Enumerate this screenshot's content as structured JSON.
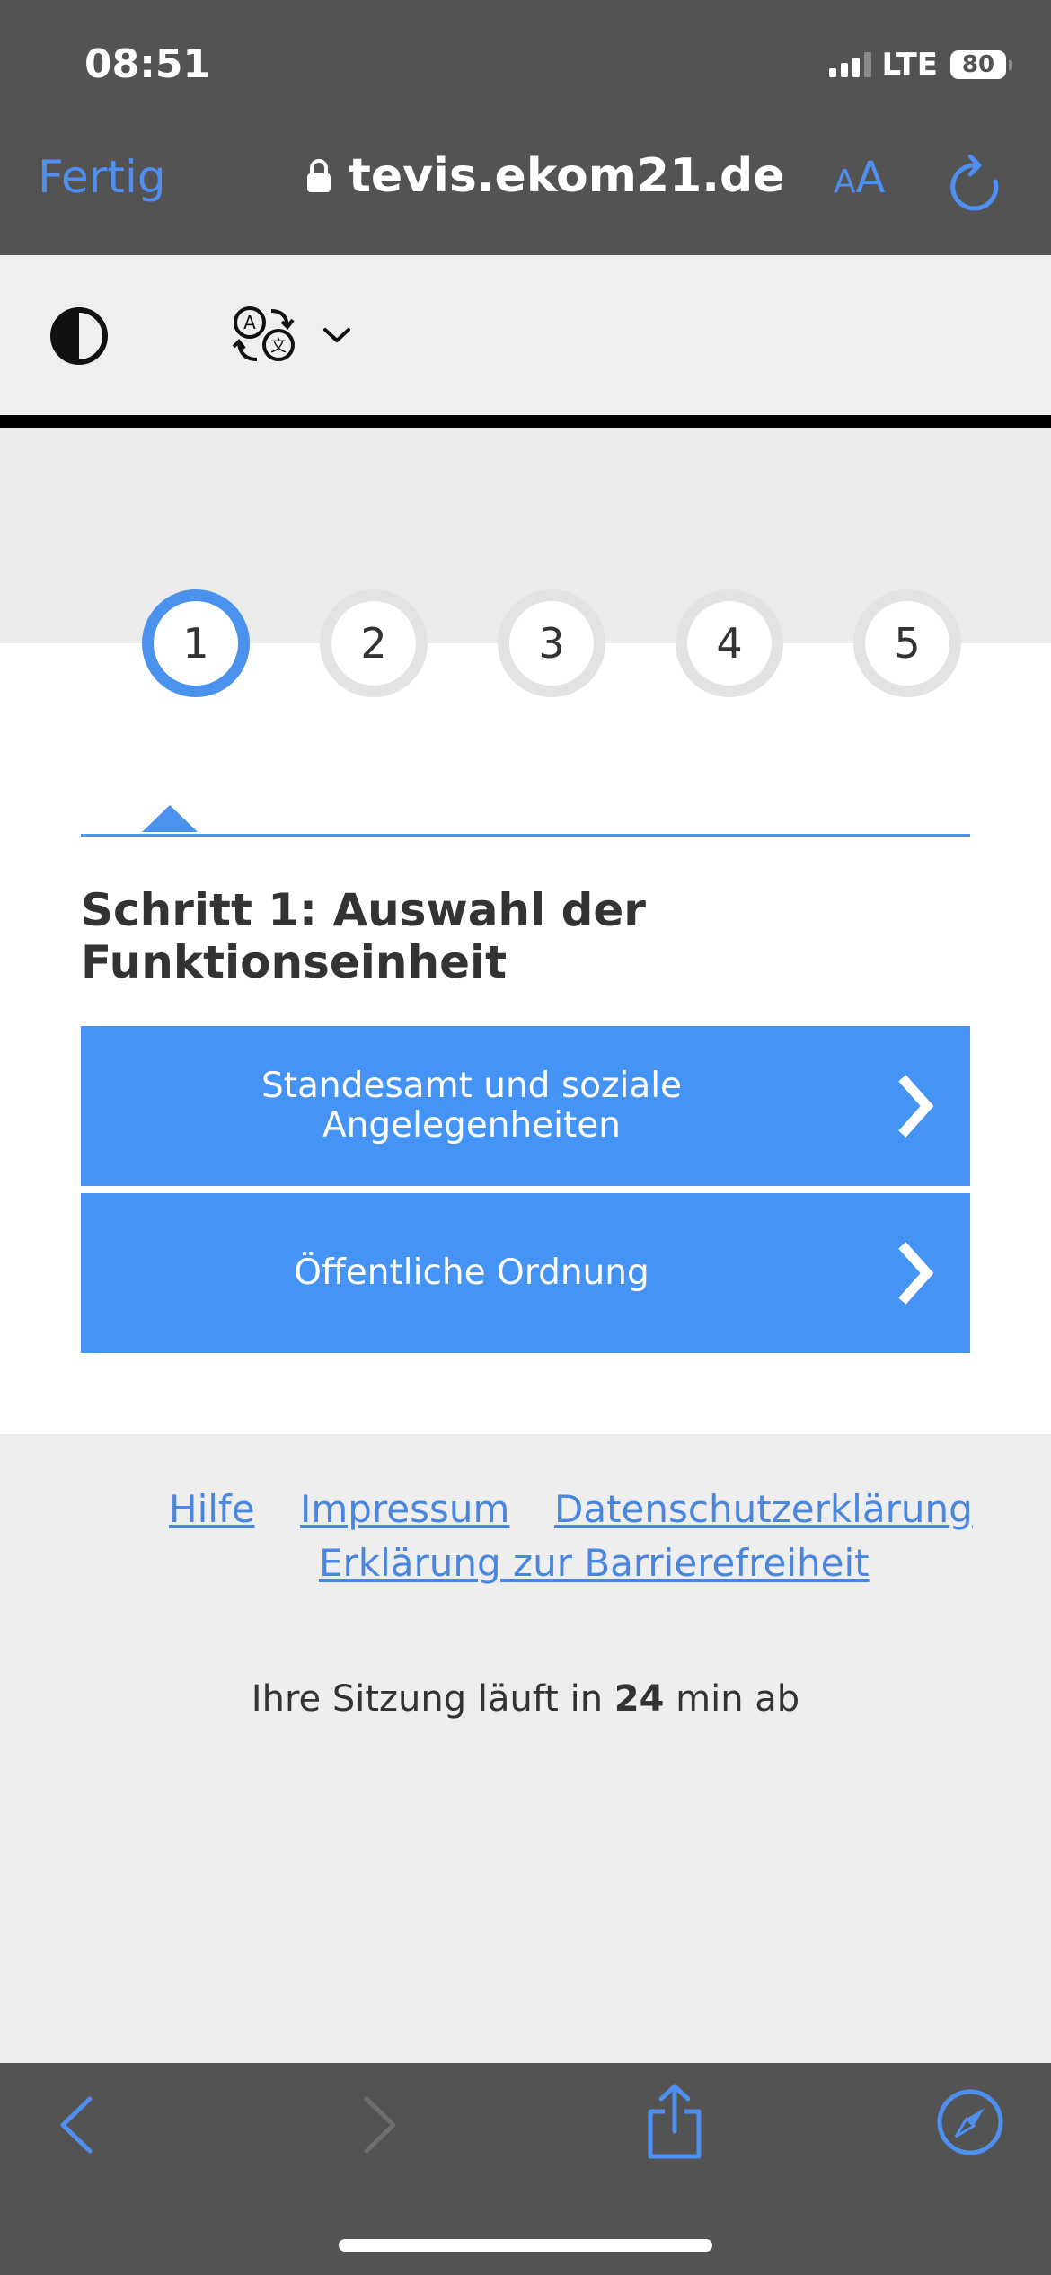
{
  "status_bar": {
    "time": "08:51",
    "network": "LTE",
    "battery": "80"
  },
  "browser": {
    "done_label": "Fertig",
    "url": "tevis.ekom21.de",
    "text_size_big": "A",
    "text_size_small": "A"
  },
  "toolbar": {
    "contrast_icon": "contrast-icon",
    "language_icon": "translate-icon"
  },
  "steps": [
    "1",
    "2",
    "3",
    "4",
    "5"
  ],
  "active_step": "1",
  "heading": "Schritt 1: Auswahl der Funktionseinheit",
  "options": [
    {
      "label": "Standesamt und soziale\nAngelegenheiten"
    },
    {
      "label": "Öffentliche Ordnung"
    }
  ],
  "footer": {
    "links": [
      "Hilfe",
      "Impressum",
      "Datenschutzerklärung",
      "Erklärung zur Barrierefreiheit"
    ]
  },
  "session": {
    "prefix": "Ihre Sitzung läuft in ",
    "minutes": "24",
    "suffix": " min ab"
  },
  "colors": {
    "accent": "#4493f5",
    "link": "#4a86e0",
    "browser_chrome": "#535353",
    "ios_blue": "#4f8ff0"
  }
}
